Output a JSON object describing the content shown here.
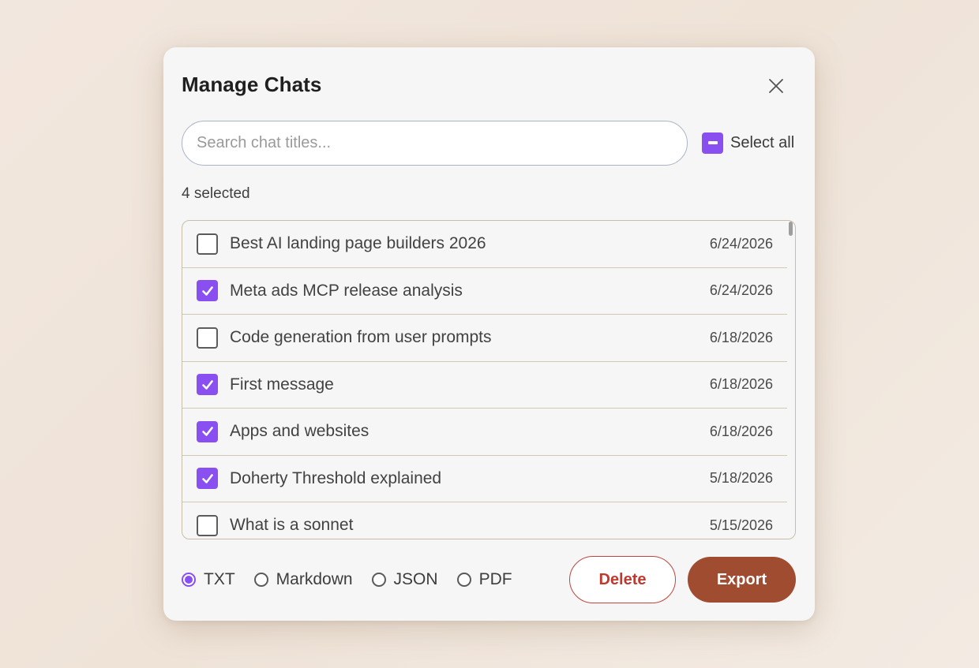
{
  "dialog": {
    "title": "Manage Chats",
    "close_icon": "close-icon"
  },
  "search": {
    "placeholder": "Search chat titles...",
    "value": ""
  },
  "select_all": {
    "label": "Select all",
    "state": "indeterminate"
  },
  "selected_count_text": "4 selected",
  "chats": [
    {
      "title": "Best AI landing page builders 2026",
      "date": "6/24/2026",
      "checked": false
    },
    {
      "title": "Meta ads MCP release analysis",
      "date": "6/24/2026",
      "checked": true
    },
    {
      "title": "Code generation from user prompts",
      "date": "6/18/2026",
      "checked": false
    },
    {
      "title": "First message",
      "date": "6/18/2026",
      "checked": true
    },
    {
      "title": "Apps and websites",
      "date": "6/18/2026",
      "checked": true
    },
    {
      "title": "Doherty Threshold explained",
      "date": "5/18/2026",
      "checked": true
    },
    {
      "title": "What is a sonnet",
      "date": "5/15/2026",
      "checked": false
    }
  ],
  "formats": [
    {
      "label": "TXT",
      "selected": true
    },
    {
      "label": "Markdown",
      "selected": false
    },
    {
      "label": "JSON",
      "selected": false
    },
    {
      "label": "PDF",
      "selected": false
    }
  ],
  "actions": {
    "delete_label": "Delete",
    "export_label": "Export"
  },
  "colors": {
    "accent": "#8a4ff0",
    "export_button": "#a04c30",
    "delete_text": "#c0392f"
  }
}
